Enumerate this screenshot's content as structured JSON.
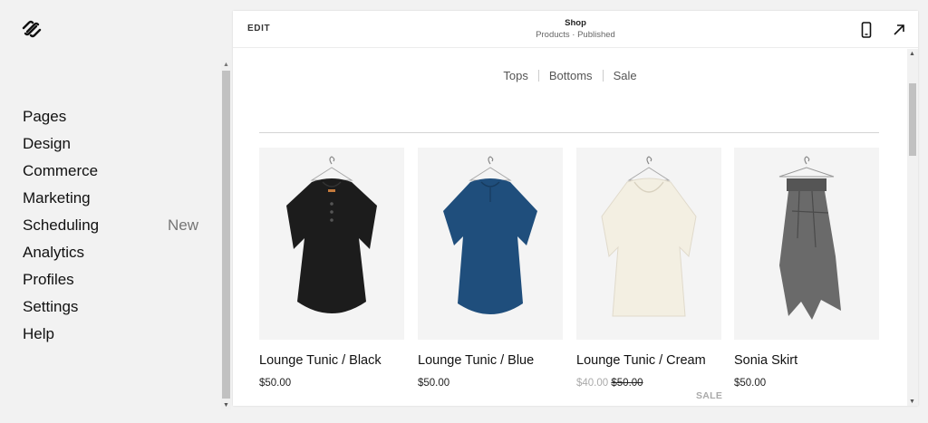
{
  "sidebar": {
    "items": [
      {
        "label": "Pages"
      },
      {
        "label": "Design"
      },
      {
        "label": "Commerce"
      },
      {
        "label": "Marketing"
      },
      {
        "label": "Scheduling",
        "badge": "New"
      },
      {
        "label": "Analytics"
      },
      {
        "label": "Profiles"
      },
      {
        "label": "Settings"
      },
      {
        "label": "Help"
      }
    ]
  },
  "preview": {
    "edit_label": "EDIT",
    "page_title": "Shop",
    "page_subtitle": "Products · Published",
    "categories": [
      "Tops",
      "Bottoms",
      "Sale"
    ],
    "products": [
      {
        "name": "Lounge Tunic / Black",
        "price": "$50.00",
        "image_icon": "black-tunic"
      },
      {
        "name": "Lounge Tunic / Blue",
        "price": "$50.00",
        "image_icon": "blue-tunic"
      },
      {
        "name": "Lounge Tunic / Cream",
        "sale_price": "$40.00",
        "original_price": "$50.00",
        "badge": "SALE",
        "image_icon": "cream-tunic"
      },
      {
        "name": "Sonia Skirt",
        "price": "$50.00",
        "image_icon": "grey-skirt"
      }
    ]
  },
  "colors": {
    "background": "#f2f2f2",
    "panel": "#ffffff",
    "text": "#111111",
    "muted": "#757575",
    "black_garment": "#1c1c1c",
    "blue_garment": "#1f4e7c",
    "cream_garment": "#f3efe2",
    "grey_garment": "#6a6a6a"
  },
  "icons": {
    "logo": "squarespace-logo-icon",
    "mobile": "mobile-view-icon",
    "open": "open-external-arrow-icon"
  }
}
